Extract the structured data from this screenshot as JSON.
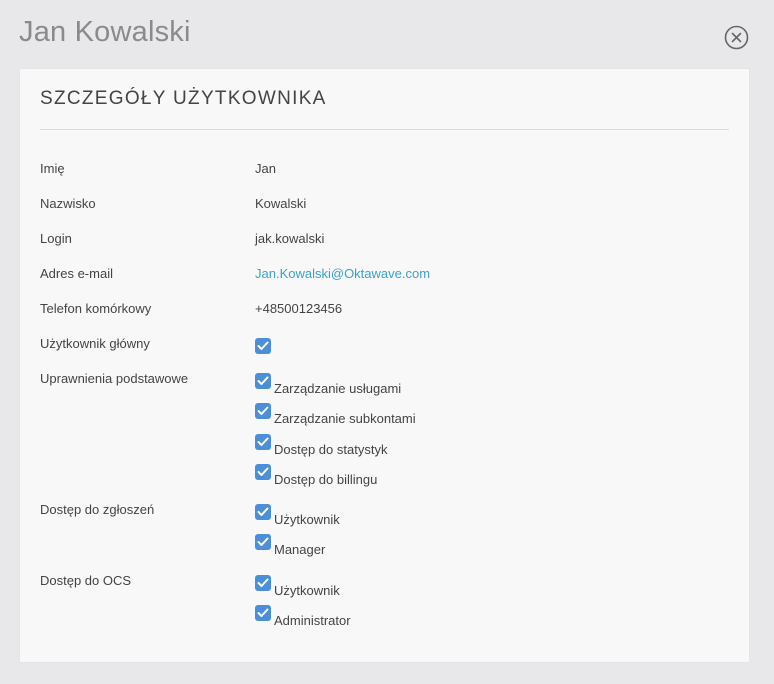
{
  "header": {
    "title": "Jan Kowalski",
    "close_icon": "close-circle-icon"
  },
  "section_title": "SZCZEGÓŁY UŻYTKOWNIKA",
  "fields": {
    "first_name": {
      "label": "Imię",
      "value": "Jan"
    },
    "last_name": {
      "label": "Nazwisko",
      "value": "Kowalski"
    },
    "login": {
      "label": "Login",
      "value": "jak.kowalski"
    },
    "email": {
      "label": "Adres e-mail",
      "value": "Jan.Kowalski@Oktawave.com"
    },
    "phone": {
      "label": "Telefon komórkowy",
      "value": "+48500123456"
    },
    "main_user": {
      "label": "Użytkownik główny",
      "checked": true
    }
  },
  "basic_permissions": {
    "label": "Uprawnienia podstawowe",
    "items": [
      {
        "label": "Zarządzanie usługami",
        "checked": true
      },
      {
        "label": "Zarządzanie subkontami",
        "checked": true
      },
      {
        "label": "Dostęp do statystyk",
        "checked": true
      },
      {
        "label": "Dostęp do billingu",
        "checked": true
      }
    ]
  },
  "ticket_access": {
    "label": "Dostęp do zgłoszeń",
    "items": [
      {
        "label": "Użytkownik",
        "checked": true
      },
      {
        "label": "Manager",
        "checked": true
      }
    ]
  },
  "ocs_access": {
    "label": "Dostęp do OCS",
    "items": [
      {
        "label": "Użytkownik",
        "checked": true
      },
      {
        "label": "Administrator",
        "checked": true
      }
    ]
  },
  "colors": {
    "accent": "#4a8fd8",
    "link": "#3aa3c9"
  }
}
